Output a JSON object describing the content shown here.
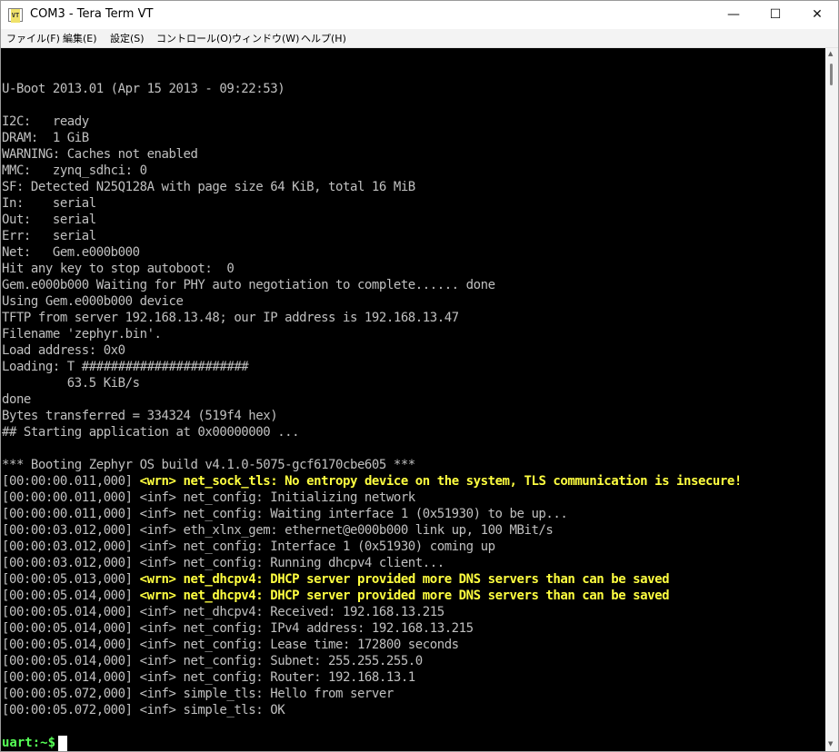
{
  "window": {
    "title": "COM3 - Tera Term VT",
    "icon": "VT",
    "controls": {
      "minimize": "—",
      "maximize": "☐",
      "close": "✕"
    }
  },
  "menu": [
    "ファイル(F)",
    "編集(E)",
    "設定(S)",
    "コントロール(O)",
    "ウィンドウ(W)",
    "ヘルプ(H)"
  ],
  "colors": {
    "terminal_bg": "#000000",
    "terminal_fg": "#c0c0c0",
    "warning": "#ffff40",
    "prompt": "#55ff55"
  },
  "terminal": {
    "lines": [
      {
        "text": "U-Boot 2013.01 (Apr 15 2013 - 09:22:53)"
      },
      {
        "text": ""
      },
      {
        "text": "I2C:   ready"
      },
      {
        "text": "DRAM:  1 GiB"
      },
      {
        "text": "WARNING: Caches not enabled"
      },
      {
        "text": "MMC:   zynq_sdhci: 0"
      },
      {
        "text": "SF: Detected N25Q128A with page size 64 KiB, total 16 MiB"
      },
      {
        "text": "In:    serial"
      },
      {
        "text": "Out:   serial"
      },
      {
        "text": "Err:   serial"
      },
      {
        "text": "Net:   Gem.e000b000"
      },
      {
        "text": "Hit any key to stop autoboot:  0"
      },
      {
        "text": "Gem.e000b000 Waiting for PHY auto negotiation to complete...... done"
      },
      {
        "text": "Using Gem.e000b000 device"
      },
      {
        "text": "TFTP from server 192.168.13.48; our IP address is 192.168.13.47"
      },
      {
        "text": "Filename 'zephyr.bin'."
      },
      {
        "text": "Load address: 0x0"
      },
      {
        "text": "Loading: T #######################"
      },
      {
        "text": "         63.5 KiB/s"
      },
      {
        "text": "done"
      },
      {
        "text": "Bytes transferred = 334324 (519f4 hex)"
      },
      {
        "text": "## Starting application at 0x00000000 ..."
      },
      {
        "text": ""
      },
      {
        "text": "*** Booting Zephyr OS build v4.1.0-5075-gcf6170cbe605 ***"
      },
      {
        "prefix": "[00:00:00.011,000] ",
        "warn": "<wrn> net_sock_tls: No entropy device on the system, TLS communication is insecure!"
      },
      {
        "text": "[00:00:00.011,000] <inf> net_config: Initializing network"
      },
      {
        "text": "[00:00:00.011,000] <inf> net_config: Waiting interface 1 (0x51930) to be up..."
      },
      {
        "text": "[00:00:03.012,000] <inf> eth_xlnx_gem: ethernet@e000b000 link up, 100 MBit/s"
      },
      {
        "text": "[00:00:03.012,000] <inf> net_config: Interface 1 (0x51930) coming up"
      },
      {
        "text": "[00:00:03.012,000] <inf> net_config: Running dhcpv4 client..."
      },
      {
        "prefix": "[00:00:05.013,000] ",
        "warn": "<wrn> net_dhcpv4: DHCP server provided more DNS servers than can be saved"
      },
      {
        "prefix": "[00:00:05.014,000] ",
        "warn": "<wrn> net_dhcpv4: DHCP server provided more DNS servers than can be saved"
      },
      {
        "text": "[00:00:05.014,000] <inf> net_dhcpv4: Received: 192.168.13.215"
      },
      {
        "text": "[00:00:05.014,000] <inf> net_config: IPv4 address: 192.168.13.215"
      },
      {
        "text": "[00:00:05.014,000] <inf> net_config: Lease time: 172800 seconds"
      },
      {
        "text": "[00:00:05.014,000] <inf> net_config: Subnet: 255.255.255.0"
      },
      {
        "text": "[00:00:05.014,000] <inf> net_config: Router: 192.168.13.1"
      },
      {
        "text": "[00:00:05.072,000] <inf> simple_tls: Hello from server"
      },
      {
        "text": "[00:00:05.072,000] <inf> simple_tls: OK"
      }
    ],
    "prompt": "uart:~$ "
  }
}
